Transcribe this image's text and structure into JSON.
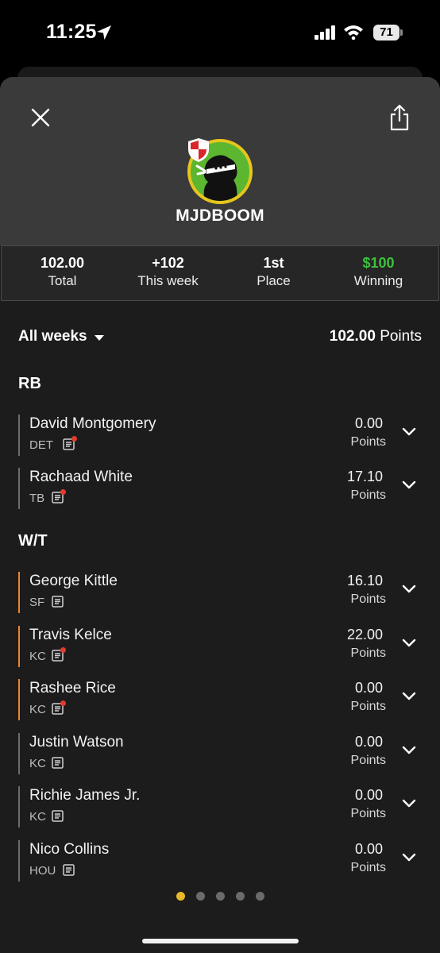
{
  "status": {
    "time": "11:25",
    "battery": "71"
  },
  "team": {
    "name": "MJDBOOM"
  },
  "stats": [
    {
      "value": "102.00",
      "label": "Total",
      "color": "#ffffff"
    },
    {
      "value": "+102",
      "label": "This week",
      "color": "#ffffff"
    },
    {
      "value": "1st",
      "label": "Place",
      "color": "#ffffff"
    },
    {
      "value": "$100",
      "label": "Winning",
      "color": "#3cc13b"
    }
  ],
  "filter": {
    "selected": "All weeks",
    "total_value": "102.00",
    "total_unit": "Points"
  },
  "sections": [
    {
      "title": "RB",
      "players": [
        {
          "name": "David Montgomery",
          "team": "DET",
          "points": "0.00",
          "points_label": "Points",
          "has_alert": true,
          "highlight": false
        },
        {
          "name": "Rachaad White",
          "team": "TB",
          "points": "17.10",
          "points_label": "Points",
          "has_alert": true,
          "highlight": false
        }
      ]
    },
    {
      "title": "W/T",
      "players": [
        {
          "name": "George Kittle",
          "team": "SF",
          "points": "16.10",
          "points_label": "Points",
          "has_alert": false,
          "highlight": true
        },
        {
          "name": "Travis Kelce",
          "team": "KC",
          "points": "22.00",
          "points_label": "Points",
          "has_alert": true,
          "highlight": true
        },
        {
          "name": "Rashee Rice",
          "team": "KC",
          "points": "0.00",
          "points_label": "Points",
          "has_alert": true,
          "highlight": true
        },
        {
          "name": "Justin Watson",
          "team": "KC",
          "points": "0.00",
          "points_label": "Points",
          "has_alert": false,
          "highlight": false
        },
        {
          "name": "Richie James Jr.",
          "team": "KC",
          "points": "0.00",
          "points_label": "Points",
          "has_alert": false,
          "highlight": false
        },
        {
          "name": "Nico Collins",
          "team": "HOU",
          "points": "0.00",
          "points_label": "Points",
          "has_alert": false,
          "highlight": false
        }
      ]
    }
  ],
  "pagination": {
    "pages": 5,
    "active": 0
  }
}
